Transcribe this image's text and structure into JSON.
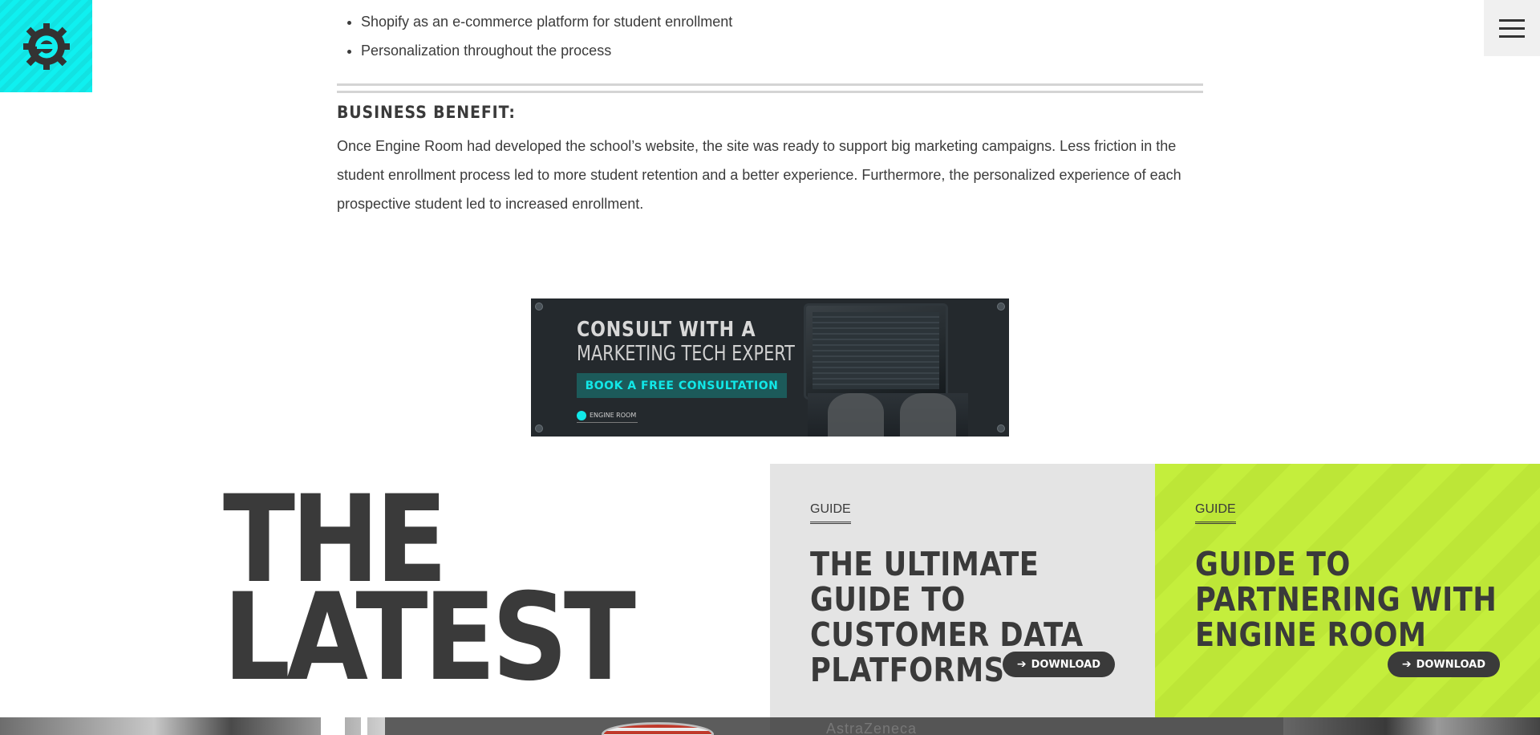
{
  "colors": {
    "accent_cyan": "#0ff0f0",
    "lime": "#c4ee3c",
    "dark": "#3a3a3a",
    "grey_card": "#e4e4e4"
  },
  "header": {
    "logo_icon": "engine-room-gear-e-icon",
    "menu_icon": "hamburger-icon"
  },
  "article": {
    "bullets": [
      "Shopify as an e-commerce platform for student enrollment",
      "Personalization throughout the process"
    ],
    "benefit_heading": "BUSINESS BENEFIT:",
    "benefit_text": "Once Engine Room had developed the school’s website, the site was ready to support big marketing campaigns. Less friction in the student enrollment process led to more student retention and a better experience. Furthermore, the personalized experience of each prospective student led to increased enrollment."
  },
  "banner": {
    "line1": "CONSULT WITH A",
    "line2": "MARKETING TECH EXPERT",
    "button": "BOOK A FREE CONSULTATION",
    "brand": "ENGINE ROOM"
  },
  "latest": {
    "line1": "THE",
    "line2": "LATEST"
  },
  "cards": [
    {
      "tag": "GUIDE",
      "title": "THE ULTIMATE GUIDE TO CUSTOMER DATA PLATFORMS",
      "button": "DOWNLOAD"
    },
    {
      "tag": "GUIDE",
      "title": "GUIDE TO PARTNERING WITH ENGINE ROOM",
      "button": "DOWNLOAD"
    }
  ],
  "strip": {
    "logo_text": "AstraZeneca"
  }
}
